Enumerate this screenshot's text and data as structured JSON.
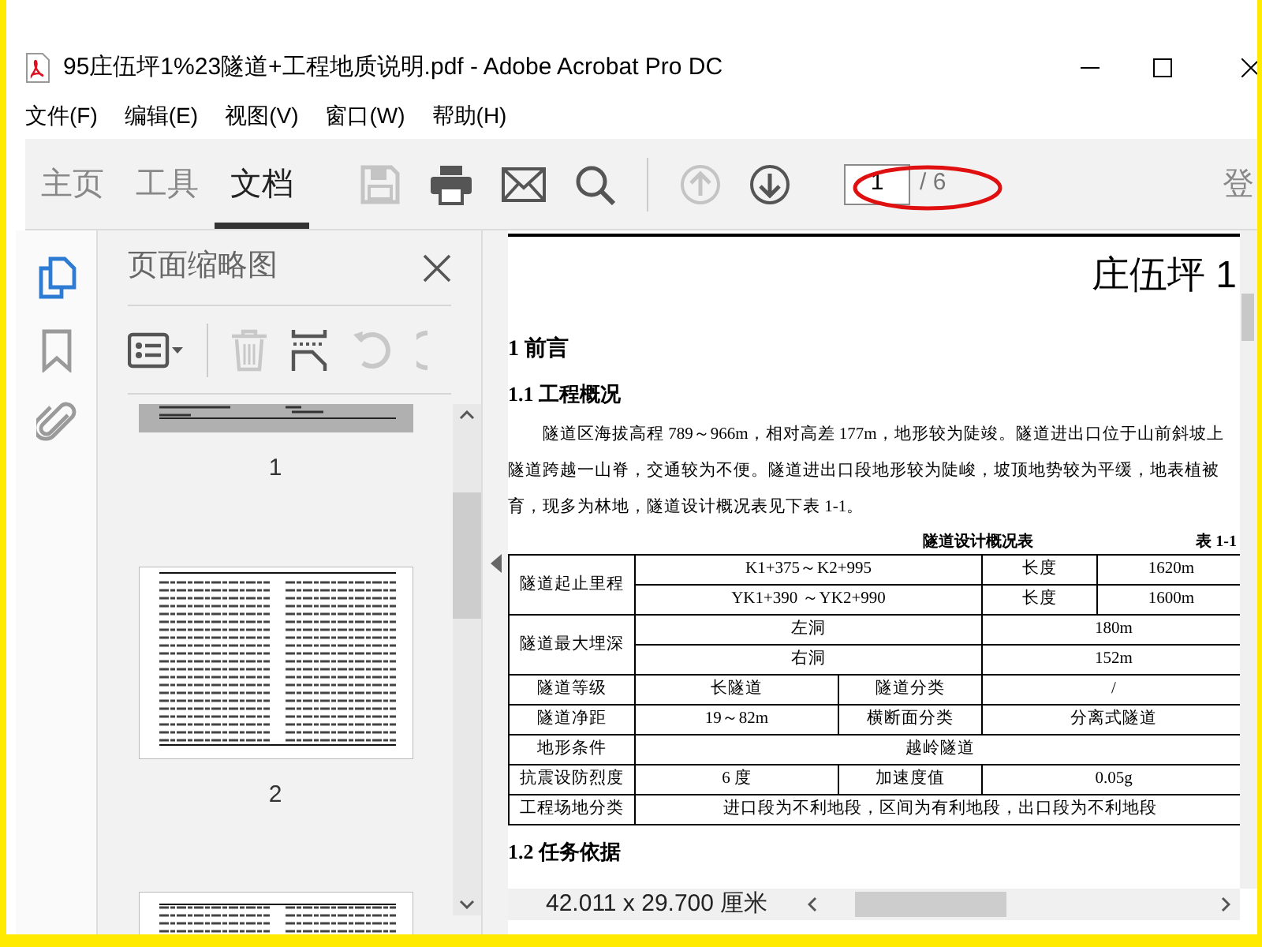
{
  "window": {
    "title": "95庄伍坪1%23隧道+工程地质说明.pdf - Adobe Acrobat Pro DC"
  },
  "menu": [
    "文件(F)",
    "编辑(E)",
    "视图(V)",
    "窗口(W)",
    "帮助(H)"
  ],
  "toolbar": {
    "tabs": [
      {
        "label": "主页",
        "selected": false
      },
      {
        "label": "工具",
        "selected": false
      },
      {
        "label": "文档",
        "selected": true
      }
    ],
    "tools": [
      {
        "kind": "save",
        "disabled": true
      },
      {
        "kind": "print",
        "disabled": false
      },
      {
        "kind": "mail",
        "disabled": false
      },
      {
        "kind": "search",
        "disabled": false
      },
      {
        "kind": "separator"
      },
      {
        "kind": "prev",
        "disabled": true
      },
      {
        "kind": "next",
        "disabled": false
      }
    ],
    "page_field": {
      "value": "1"
    },
    "page_total": "/ 6",
    "sign_in": "登"
  },
  "sidebar_icons": [
    {
      "kind": "pages",
      "selected": true
    },
    {
      "kind": "bookmark",
      "selected": false
    },
    {
      "kind": "attachment",
      "selected": false
    }
  ],
  "thumbnail_panel": {
    "title": "页面缩略图",
    "tools": [
      {
        "kind": "options",
        "disabled": false
      },
      {
        "kind": "separator"
      },
      {
        "kind": "delete",
        "disabled": true
      },
      {
        "kind": "insert",
        "disabled": false
      },
      {
        "kind": "rotate",
        "disabled": true
      },
      {
        "kind": "rotate_partial",
        "disabled": true
      }
    ],
    "pages": [
      {
        "kind": "top_cut",
        "label": "1",
        "selected": true
      },
      {
        "kind": "full",
        "label": "2",
        "selected": false
      },
      {
        "kind": "bottom_cut",
        "selected": false
      }
    ]
  },
  "document": {
    "title": "庄伍坪 1",
    "heading_1": "1 前言",
    "heading_1_1": "1.1 工程概况",
    "paragraph_lines": [
      "隧道区海拔高程 789～966m，相对高差 177m，地形较为陡竣。隧道进出口位于山前斜坡上",
      "隧道跨越一山脊，交通较为不便。隧道进出口段地形较为陡峻，坡顶地势较为平缓，地表植被",
      "育，现多为林地，隧道设计概况表见下表 1-1。"
    ],
    "table": {
      "caption": "隧道设计概况表",
      "number": "表 1-1",
      "rows": [
        [
          {
            "text": "隧道起止里程",
            "rowspan": 2
          },
          {
            "text": "K1+375～K2+995",
            "colspan": 2
          },
          {
            "text": "长度"
          },
          {
            "text": "1620m"
          }
        ],
        [
          {
            "text": "YK1+390 ～YK2+990",
            "colspan": 2
          },
          {
            "text": "长度"
          },
          {
            "text": "1600m"
          }
        ],
        [
          {
            "text": "隧道最大埋深",
            "rowspan": 2
          },
          {
            "text": "左洞",
            "colspan": 2
          },
          {
            "text": "180m",
            "colspan": 2
          }
        ],
        [
          {
            "text": "右洞",
            "colspan": 2
          },
          {
            "text": "152m",
            "colspan": 2
          }
        ],
        [
          {
            "text": "隧道等级"
          },
          {
            "text": "长隧道"
          },
          {
            "text": "隧道分类"
          },
          {
            "text": "/",
            "colspan": 2
          }
        ],
        [
          {
            "text": "隧道净距"
          },
          {
            "text": "19～82m"
          },
          {
            "text": "横断面分类"
          },
          {
            "text": "分离式隧道",
            "colspan": 2
          }
        ],
        [
          {
            "text": "地形条件"
          },
          {
            "text": "越岭隧道",
            "colspan": 4
          }
        ],
        [
          {
            "text": "抗震设防烈度"
          },
          {
            "text": "6 度"
          },
          {
            "text": "加速度值"
          },
          {
            "text": "0.05g",
            "colspan": 2
          }
        ],
        [
          {
            "text": "工程场地分类"
          },
          {
            "text": "进口段为不利地段，区间为有利地段，出口段为不利地段",
            "colspan": 4
          }
        ]
      ]
    },
    "heading_1_2": "1.2 任务依据"
  },
  "status_bar": {
    "page_size": "42.011 x 29.700 厘米"
  }
}
